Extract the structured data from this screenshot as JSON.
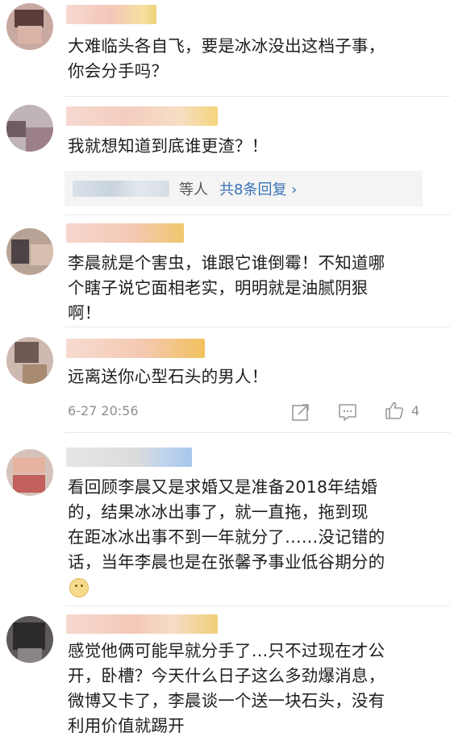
{
  "comments": [
    {
      "text": "大难临头各自飞，要是冰冰没出这档子事，\n你会分手吗？"
    },
    {
      "text": "我就想知道到底谁更渣？！",
      "replies": {
        "suffix": "等人",
        "link": "共8条回复 ›"
      }
    },
    {
      "text": "李晨就是个害虫，谁跟它谁倒霉！不知道哪\n个瞎子说它面相老实，明明就是油腻阴狠\n啊！"
    },
    {
      "text": "远离送你心型石头的男人！",
      "time": "6-27 20:56",
      "likes": "4"
    },
    {
      "text": "看回顾李晨又是求婚又是准备2018年结婚\n的，结果冰冰出事了，就一直拖，拖到现\n在距冰冰出事不到一年就分了……没记错的\n话，当年李晨也是在张馨予事业低谷期分的"
    },
    {
      "text": "感觉他俩可能早就分手了…只不过现在才公\n开，卧槽？今天什么日子这么多劲爆消息，\n微博又卡了，李晨谈一个送一块石头，没有\n利用价值就踢开"
    }
  ],
  "icons": [
    "share-icon",
    "comment-icon",
    "thumbs-up-icon",
    "emoji-icon"
  ],
  "colors": {
    "link": "#3a73b8",
    "meta": "#8f8f8f",
    "reply_bg": "#f4f4f4"
  }
}
